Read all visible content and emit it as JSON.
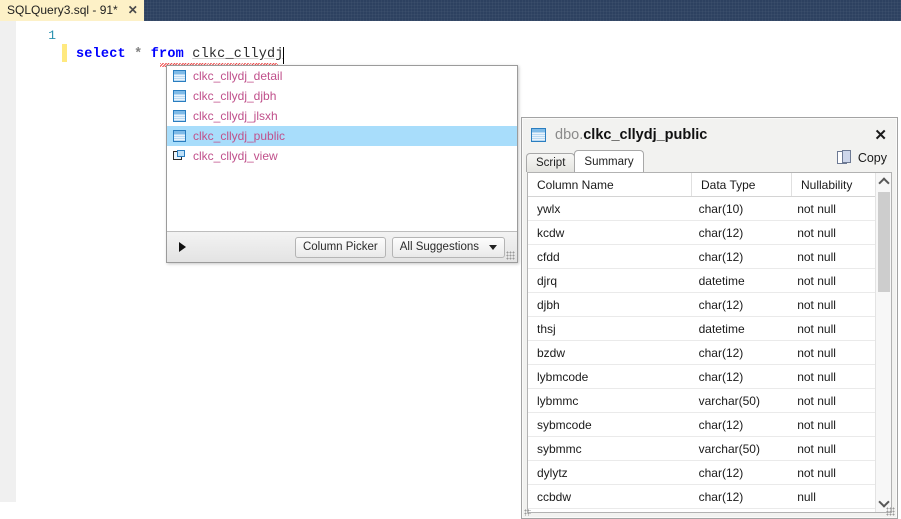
{
  "window": {
    "titlebar_color": "#2d4160",
    "tab": {
      "label": "SQLQuery3.sql - 91*",
      "close_glyph": "✕"
    }
  },
  "editor": {
    "line_number": "1",
    "code": {
      "keyword_select": "select",
      "star": "*",
      "keyword_from": "from",
      "identifier": "clkc_cllydj",
      "full_text": "select * from clkc_cllydj"
    }
  },
  "intellisense": {
    "items": [
      {
        "label": "clkc_cllydj_detail",
        "icon": "table-icon",
        "selected": false
      },
      {
        "label": "clkc_cllydj_djbh",
        "icon": "table-icon",
        "selected": false
      },
      {
        "label": "clkc_cllydj_jlsxh",
        "icon": "table-icon",
        "selected": false
      },
      {
        "label": "clkc_cllydj_public",
        "icon": "table-icon",
        "selected": true
      },
      {
        "label": "clkc_cllydj_view",
        "icon": "view-icon",
        "selected": false
      }
    ],
    "footer": {
      "expand_arrow": "▶",
      "column_picker_label": "Column Picker",
      "all_suggestions_label": "All Suggestions"
    }
  },
  "object_info": {
    "icon": "table-icon",
    "schema": "dbo.",
    "object_name": "clkc_cllydj_public",
    "close_glyph": "✕",
    "tabs": [
      {
        "label": "Script",
        "active": false
      },
      {
        "label": "Summary",
        "active": true
      }
    ],
    "copy": {
      "label": "Copy",
      "icon": "copy-icon"
    },
    "grid": {
      "headers": [
        "Column Name",
        "Data Type",
        "Nullability"
      ],
      "rows": [
        [
          "ywlx",
          "char(10)",
          "not null"
        ],
        [
          "kcdw",
          "char(12)",
          "not null"
        ],
        [
          "cfdd",
          "char(12)",
          "not null"
        ],
        [
          "djrq",
          "datetime",
          "not null"
        ],
        [
          "djbh",
          "char(12)",
          "not null"
        ],
        [
          "thsj",
          "datetime",
          "not null"
        ],
        [
          "bzdw",
          "char(12)",
          "not null"
        ],
        [
          "lybmcode",
          "char(12)",
          "not null"
        ],
        [
          "lybmmc",
          "varchar(50)",
          "not null"
        ],
        [
          "sybmcode",
          "char(12)",
          "not null"
        ],
        [
          "sybmmc",
          "varchar(50)",
          "not null"
        ],
        [
          "dylytz",
          "char(12)",
          "not null"
        ],
        [
          "ccbdw",
          "char(12)",
          "null"
        ]
      ]
    }
  }
}
